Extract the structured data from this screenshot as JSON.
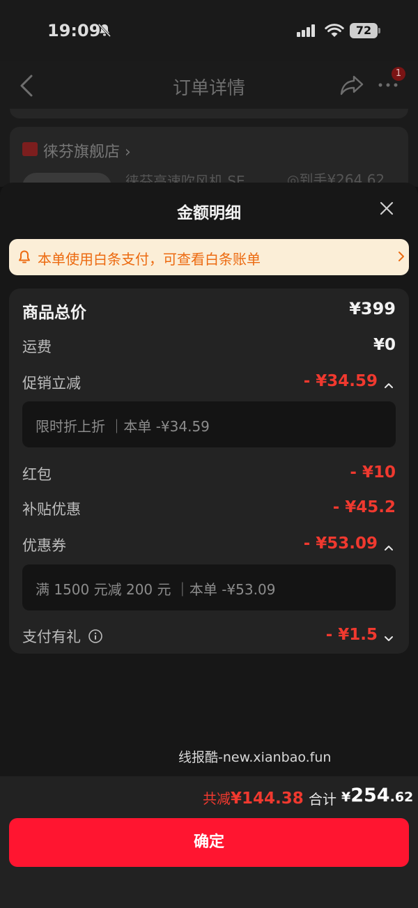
{
  "status_bar": {
    "time": "19:09",
    "battery": "72"
  },
  "background_page": {
    "nav_title": "订单详情",
    "badge_count": "1",
    "store_name": "徕芬旗舰店 ›",
    "product_name": "徕芬高速吹风机 SE",
    "price_hint": "◎到手¥264.62"
  },
  "sheet": {
    "title": "金额明细",
    "notice": "本单使用白条支付，可查看白条账单",
    "rows": {
      "goods_total": {
        "label": "商品总价",
        "value": "¥399"
      },
      "shipping": {
        "label": "运费",
        "value": "¥0"
      },
      "promo": {
        "label": "促销立减",
        "value": "- ¥34.59",
        "detail": "限时折上折 ｜本单 -¥34.59"
      },
      "red_packet": {
        "label": "红包",
        "value": "- ¥10"
      },
      "subsidy": {
        "label": "补贴优惠",
        "value": "- ¥45.2"
      },
      "coupon": {
        "label": "优惠券",
        "value": "- ¥53.09",
        "detail": "满 1500 元减 200 元 ｜本单 -¥53.09"
      },
      "pay_gift": {
        "label": "支付有礼",
        "value": "- ¥1.5"
      }
    }
  },
  "watermark": "线报酷-new.xianbao.fun",
  "footer": {
    "discount_label": "共减",
    "discount_value": "¥144.38",
    "total_label": "合计",
    "total_symbol": "¥",
    "total_int": "254",
    "total_dec": ".62",
    "confirm_label": "确定"
  },
  "colors": {
    "accent_red": "#ff1530",
    "notice_bg": "#fbeed7",
    "notice_text": "#ec6a10"
  }
}
